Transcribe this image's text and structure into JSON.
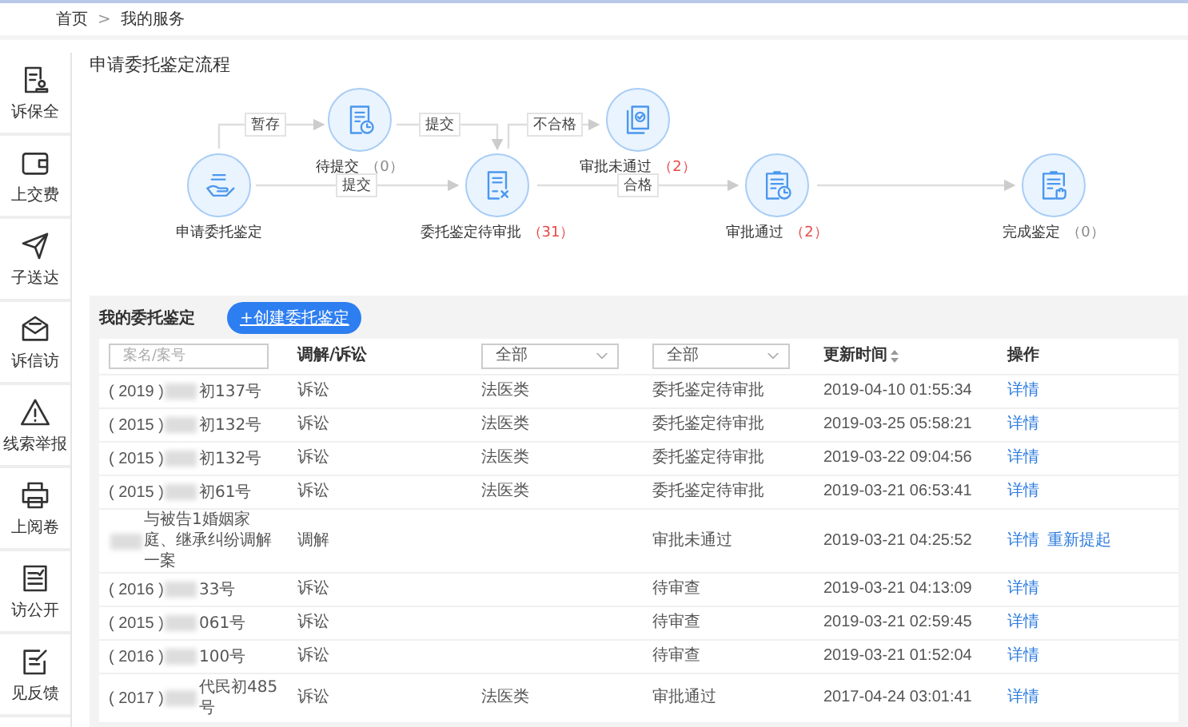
{
  "breadcrumb": {
    "items": [
      "首页",
      "我的服务"
    ],
    "separator": ">"
  },
  "sidebar": {
    "items": [
      {
        "label": "诉保全"
      },
      {
        "label": "上交费"
      },
      {
        "label": "子送达"
      },
      {
        "label": "诉信访"
      },
      {
        "label": "线索举报"
      },
      {
        "label": "上阅卷"
      },
      {
        "label": "访公开"
      },
      {
        "label": "见反馈"
      }
    ]
  },
  "flow": {
    "title": "申请委托鉴定流程",
    "nodes": [
      {
        "name": "申请委托鉴定"
      },
      {
        "name": "待提交",
        "count": "（0）",
        "alert": false
      },
      {
        "name": "委托鉴定待审批",
        "count": "（31）",
        "alert": true
      },
      {
        "name": "审批未通过",
        "count": "（2）",
        "alert": true
      },
      {
        "name": "审批通过",
        "count": "（2）",
        "alert": true
      },
      {
        "name": "完成鉴定",
        "count": "（0）",
        "alert": false
      }
    ],
    "edges": [
      {
        "kind": "labeled",
        "label": "暂存"
      },
      {
        "kind": "labeled",
        "label": "提交"
      },
      {
        "kind": "labeled",
        "label": "提交"
      },
      {
        "kind": "labeled",
        "label": "不合格"
      },
      {
        "kind": "labeled",
        "label": "合格"
      },
      {
        "kind": "plain"
      }
    ]
  },
  "list": {
    "title": "我的委托鉴定",
    "create_button": "+创建委托鉴定",
    "header": {
      "search_placeholder": "案名/案号",
      "column_2": "调解/诉讼",
      "filter_3": "全部",
      "filter_4": "全部",
      "column_5": "更新时间",
      "column_6": "操作"
    },
    "rows": [
      {
        "case_prefix": "( 2019 )",
        "case_suffix": "初137号",
        "type": "诉讼",
        "category": "法医类",
        "status": "委托鉴定待审批",
        "updated": "2019-04-10 01:55:34",
        "actions": [
          "详情"
        ]
      },
      {
        "case_prefix": "( 2015 )",
        "case_suffix": "初132号",
        "type": "诉讼",
        "category": "法医类",
        "status": "委托鉴定待审批",
        "updated": "2019-03-25 05:58:21",
        "actions": [
          "详情"
        ]
      },
      {
        "case_prefix": "( 2015 )",
        "case_suffix": "初132号",
        "type": "诉讼",
        "category": "法医类",
        "status": "委托鉴定待审批",
        "updated": "2019-03-22 09:04:56",
        "actions": [
          "详情"
        ]
      },
      {
        "case_prefix": "( 2015 )",
        "case_suffix": "初61号",
        "type": "诉讼",
        "category": "法医类",
        "status": "委托鉴定待审批",
        "updated": "2019-03-21 06:53:41",
        "actions": [
          "详情"
        ]
      },
      {
        "case_suffix": "与被告1婚姻家庭、继承纠纷调解一案",
        "type": "调解",
        "status": "审批未通过",
        "updated": "2019-03-21 04:25:52",
        "actions": [
          "详情",
          "重新提起"
        ]
      },
      {
        "case_prefix": "( 2016 )",
        "case_suffix": "33号",
        "type": "诉讼",
        "status": "待审查",
        "updated": "2019-03-21 04:13:09",
        "actions": [
          "详情"
        ]
      },
      {
        "case_prefix": "( 2015 )",
        "case_suffix": "061号",
        "type": "诉讼",
        "status": "待审查",
        "updated": "2019-03-21 02:59:45",
        "actions": [
          "详情"
        ]
      },
      {
        "case_prefix": "( 2016 )",
        "case_suffix": "100号",
        "type": "诉讼",
        "status": "待审查",
        "updated": "2019-03-21 01:52:04",
        "actions": [
          "详情"
        ]
      },
      {
        "case_prefix": "( 2017 )",
        "case_suffix": "代民初485号",
        "type": "诉讼",
        "category": "法医类",
        "status": "审批通过",
        "updated": "2017-04-24 03:01:41",
        "actions": [
          "详情"
        ]
      }
    ]
  }
}
